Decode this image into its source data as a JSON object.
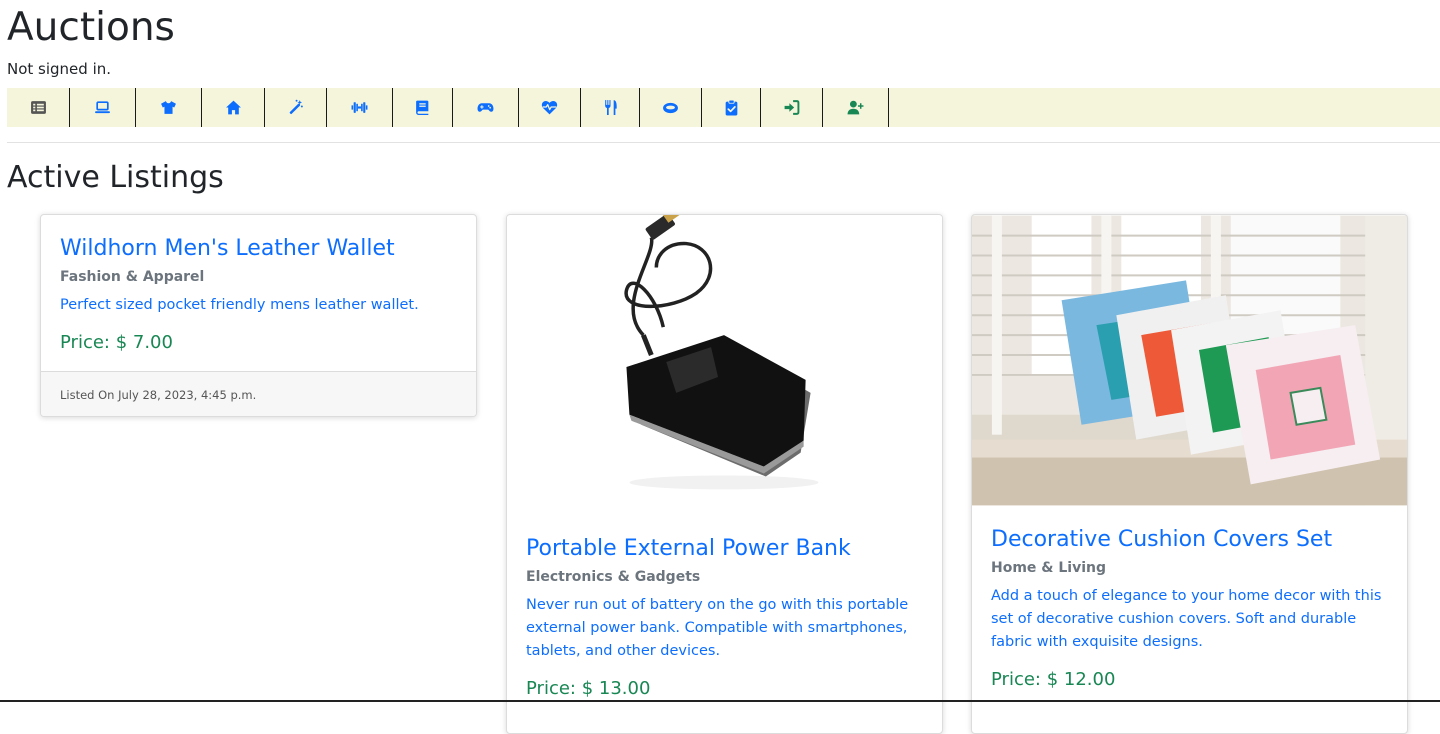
{
  "header": {
    "title": "Auctions",
    "signin_status": "Not signed in."
  },
  "nav": {
    "items": [
      {
        "name": "all-listings",
        "icon": "list-icon",
        "color": "#555555"
      },
      {
        "name": "electronics",
        "icon": "laptop-icon",
        "color": "#0d6efd"
      },
      {
        "name": "fashion",
        "icon": "tshirt-icon",
        "color": "#0d6efd"
      },
      {
        "name": "home",
        "icon": "home-icon",
        "color": "#0d6efd"
      },
      {
        "name": "toys",
        "icon": "magic-wand-icon",
        "color": "#0d6efd"
      },
      {
        "name": "sports",
        "icon": "dumbbell-icon",
        "color": "#0d6efd"
      },
      {
        "name": "books",
        "icon": "book-icon",
        "color": "#0d6efd"
      },
      {
        "name": "gaming",
        "icon": "gamepad-icon",
        "color": "#0d6efd"
      },
      {
        "name": "health",
        "icon": "heartbeat-icon",
        "color": "#0d6efd"
      },
      {
        "name": "food",
        "icon": "utensils-icon",
        "color": "#0d6efd"
      },
      {
        "name": "beauty",
        "icon": "ring-icon",
        "color": "#0d6efd"
      },
      {
        "name": "other",
        "icon": "clipboard-check-icon",
        "color": "#0d6efd"
      },
      {
        "name": "login",
        "icon": "sign-in-icon",
        "color": "#198754"
      },
      {
        "name": "register",
        "icon": "user-plus-icon",
        "color": "#198754"
      }
    ]
  },
  "main": {
    "section_title": "Active Listings",
    "listings": [
      {
        "title": "Wildhorn Men's Leather Wallet",
        "category": "Fashion & Apparel",
        "description": "Perfect sized pocket friendly mens leather wallet.",
        "price": "Price: $ 7.00",
        "listed_on": "Listed On July 28, 2023, 4:45 p.m."
      },
      {
        "title": "Portable External Power Bank",
        "category": "Electronics & Gadgets",
        "description": "Never run out of battery on the go with this portable external power bank. Compatible with smartphones, tablets, and other devices.",
        "price": "Price: $ 13.00"
      },
      {
        "title": "Decorative Cushion Covers Set",
        "category": "Home & Living",
        "description": "Add a touch of elegance to your home decor with this set of decorative cushion covers. Soft and durable fabric with exquisite designs.",
        "price": "Price: $ 12.00"
      }
    ]
  },
  "colors": {
    "link": "#0d6efd",
    "price": "#198754",
    "nav_bg": "#f5f5dc"
  }
}
